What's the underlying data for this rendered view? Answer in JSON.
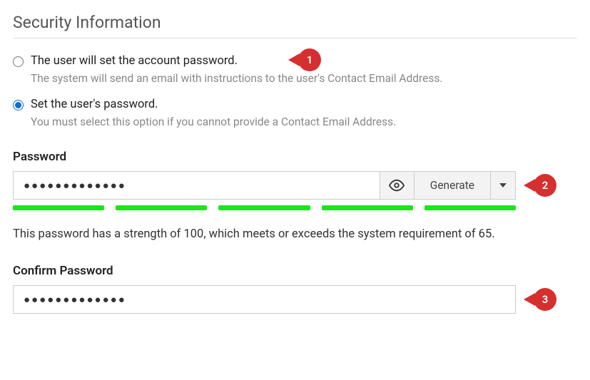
{
  "heading": "Security Information",
  "radios": {
    "opt1": {
      "label": "The user will set the account password.",
      "desc": "The system will send an email with instructions to the user's Contact Email Address."
    },
    "opt2": {
      "label": "Set the user's password.",
      "desc": "You must select this option if you cannot provide a Contact Email Address."
    }
  },
  "password": {
    "label": "Password",
    "value": "●●●●●●●●●●●●●",
    "generate": "Generate"
  },
  "strength": "This password has a strength of 100, which meets or exceeds the system requirement of 65.",
  "confirm": {
    "label": "Confirm Password",
    "value": "●●●●●●●●●●●●●"
  },
  "callouts": {
    "one": "1",
    "two": "2",
    "three": "3"
  }
}
